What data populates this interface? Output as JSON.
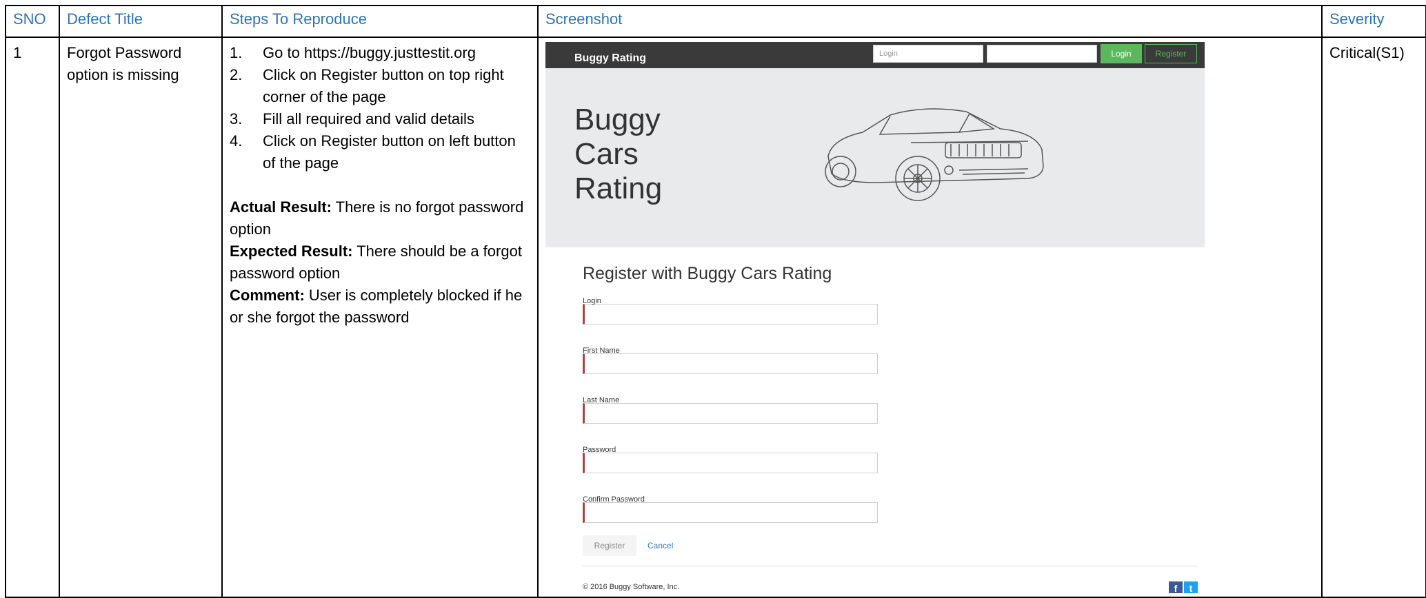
{
  "headers": [
    "SNO",
    "Defect Title",
    "Steps To Reproduce",
    "Screenshot",
    "Severity"
  ],
  "row": {
    "sno": "1",
    "title": "Forgot Password option is missing",
    "steps": [
      {
        "num": "1.",
        "text": "Go to https://buggy.justtestit.org"
      },
      {
        "num": "2.",
        "text": "Click on Register button on top right corner of the page"
      },
      {
        "num": "3.",
        "text": "Fill all required and valid details"
      },
      {
        "num": "4.",
        "text": "Click on Register button on left button of the page"
      }
    ],
    "actual_label": "Actual Result:",
    "actual_text": " There is no forgot password option",
    "expected_label": "Expected Result:",
    "expected_text": " There should be a forgot password option",
    "comment_label": "Comment:",
    "comment_text": " User is completely blocked if he or she forgot the password",
    "severity": "Critical(S1)"
  },
  "screenshot": {
    "brand": "Buggy Rating",
    "nav_login_placeholder": "Login",
    "nav_login_button": "Login",
    "nav_register_button": "Register",
    "hero_title": [
      "Buggy",
      "Cars",
      "Rating"
    ],
    "form_title": "Register with Buggy Cars Rating",
    "fields": [
      "Login",
      "First Name",
      "Last Name",
      "Password",
      "Confirm Password"
    ],
    "register_button": "Register",
    "cancel_link": "Cancel",
    "copyright": "© 2016 Buggy Software, Inc.",
    "icons": [
      "facebook-icon",
      "twitter-icon"
    ],
    "colors": {
      "nav_bg": "#3a3a3a",
      "green": "#5cb85c",
      "error": "#a94442",
      "hero_bg": "#e9eaeb"
    }
  }
}
